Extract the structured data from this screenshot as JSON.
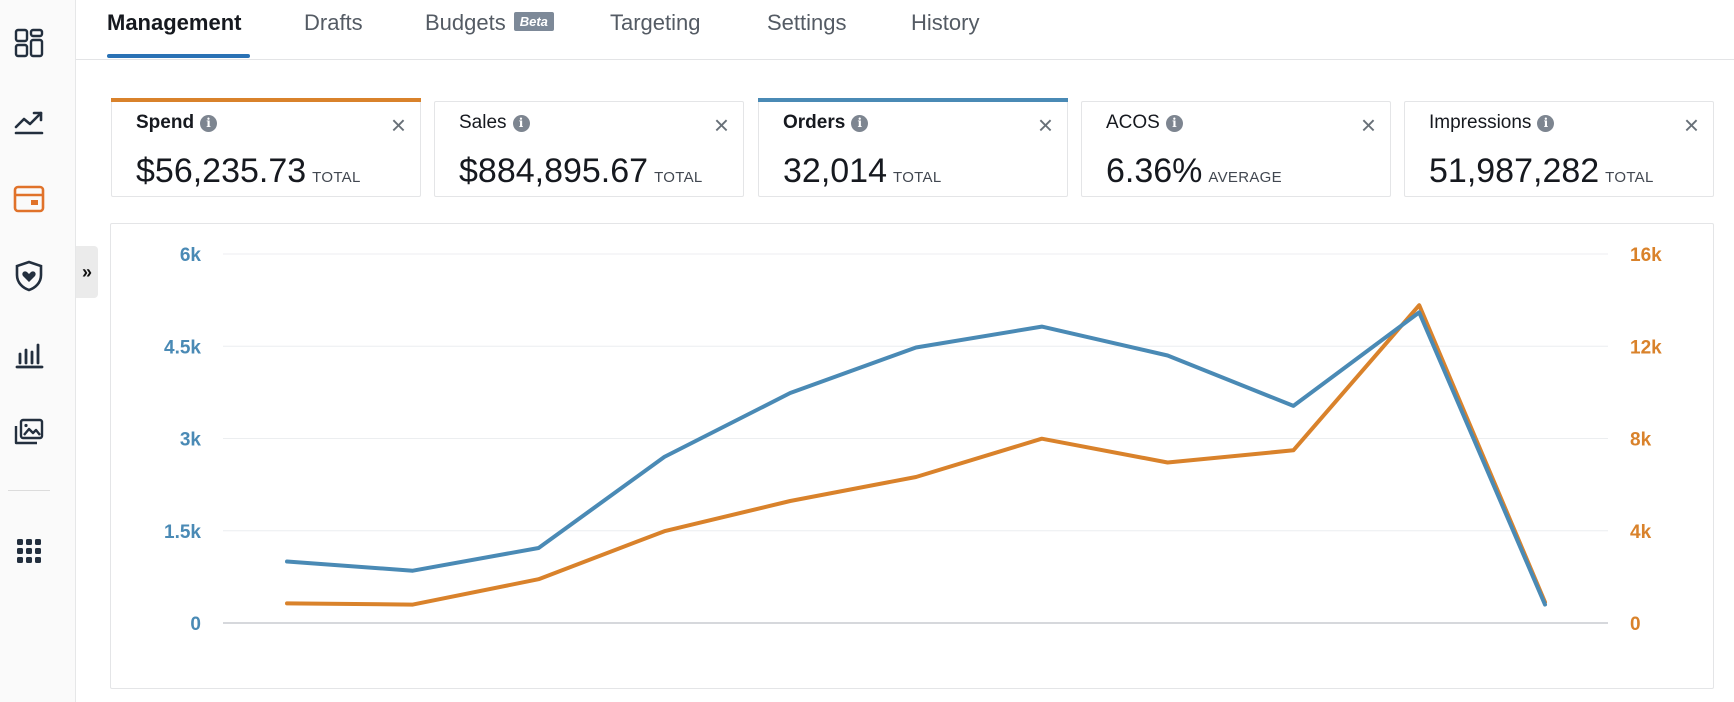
{
  "tabs": [
    {
      "label": "Management",
      "active": true
    },
    {
      "label": "Drafts"
    },
    {
      "label": "Budgets",
      "badge": "Beta"
    },
    {
      "label": "Targeting"
    },
    {
      "label": "Settings"
    },
    {
      "label": "History"
    }
  ],
  "sidebar": {
    "icons": [
      "dashboard-icon",
      "trending-up-icon",
      "campaign-icon",
      "shield-heart-icon",
      "bar-chart-icon",
      "media-library-icon",
      "apps-grid-icon"
    ],
    "active_icon": "campaign-icon",
    "toggle": "»"
  },
  "metrics": [
    {
      "label": "Spend",
      "value": "$56,235.73",
      "unit": "TOTAL",
      "selected": true,
      "accent": "#d9822b"
    },
    {
      "label": "Sales",
      "value": "$884,895.67",
      "unit": "TOTAL",
      "selected": false
    },
    {
      "label": "Orders",
      "value": "32,014",
      "unit": "TOTAL",
      "selected": true,
      "accent": "#4a8ab5"
    },
    {
      "label": "ACOS",
      "value": "6.36%",
      "unit": "AVERAGE",
      "selected": false
    },
    {
      "label": "Impressions",
      "value": "51,987,282",
      "unit": "TOTAL",
      "selected": false
    }
  ],
  "colors": {
    "orders": "#4a8ab5",
    "spend": "#d9822b",
    "tab_accent": "#2a72b5"
  },
  "chart_data": {
    "type": "line",
    "left_axis": {
      "ticks": [
        "0",
        "1.5k",
        "3k",
        "4.5k",
        "6k"
      ],
      "range": [
        0,
        6000
      ],
      "color": "#4a8ab5"
    },
    "right_axis": {
      "ticks": [
        "0",
        "4k",
        "8k",
        "12k",
        "16k"
      ],
      "range": [
        0,
        16000
      ],
      "color": "#d9822b"
    },
    "grid": true,
    "series": [
      {
        "axis": "left",
        "color": "#4a8ab5",
        "values": [
          1000,
          850,
          1220,
          2700,
          3740,
          4480,
          4820,
          4350,
          3530,
          5050,
          300
        ]
      },
      {
        "axis": "right",
        "color": "#d9822b",
        "values": [
          850,
          800,
          1900,
          3980,
          5290,
          6330,
          7990,
          6960,
          7490,
          13780,
          900
        ]
      }
    ]
  }
}
